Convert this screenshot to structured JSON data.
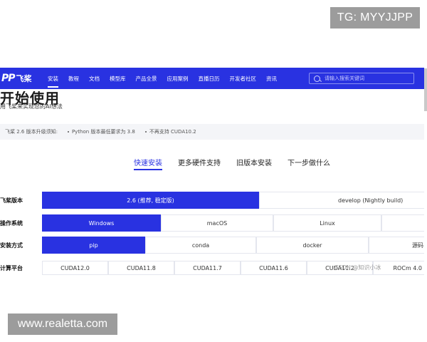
{
  "watermarks": {
    "top": "TG: MYYJJPP",
    "bottom": "www.realetta.com"
  },
  "nav": {
    "logo_mark": "PP",
    "logo_text": "飞桨",
    "items": [
      "安装",
      "教程",
      "文档",
      "模型库",
      "产品全景",
      "应用案例",
      "直播日历",
      "开发者社区",
      "资讯"
    ],
    "active_index": 0,
    "search_placeholder": "请输入搜索关键词"
  },
  "hero": {
    "title": "开始使用",
    "subtitle": "用飞桨来实现您的AI想法"
  },
  "notice": {
    "items": [
      "飞桨 2.6 版本升级须知:",
      "Python 版本最低要求为 3.8",
      "不再支持 CUDA10.2"
    ]
  },
  "tabs": {
    "items": [
      "快速安装",
      "更多硬件支持",
      "旧版本安装",
      "下一步做什么"
    ],
    "active_index": 0
  },
  "rows": {
    "version": {
      "label": "飞桨版本",
      "options": [
        "2.6 (推荐, 稳定版)",
        "develop (Nightly build)"
      ],
      "selected": 0
    },
    "os": {
      "label": "操作系统",
      "options": [
        "Windows",
        "macOS",
        "Linux",
        ""
      ],
      "selected": 0
    },
    "method": {
      "label": "安装方式",
      "options": [
        "pip",
        "conda",
        "docker",
        "源码"
      ],
      "selected": 0
    },
    "platform": {
      "label": "计算平台",
      "options": [
        "CUDA12.0",
        "CUDA11.8",
        "CUDA11.7",
        "CUDA11.6",
        "CUDA11.2",
        "ROCm 4.0"
      ]
    }
  },
  "csdn_watermark": "CSDN @知识小冰"
}
